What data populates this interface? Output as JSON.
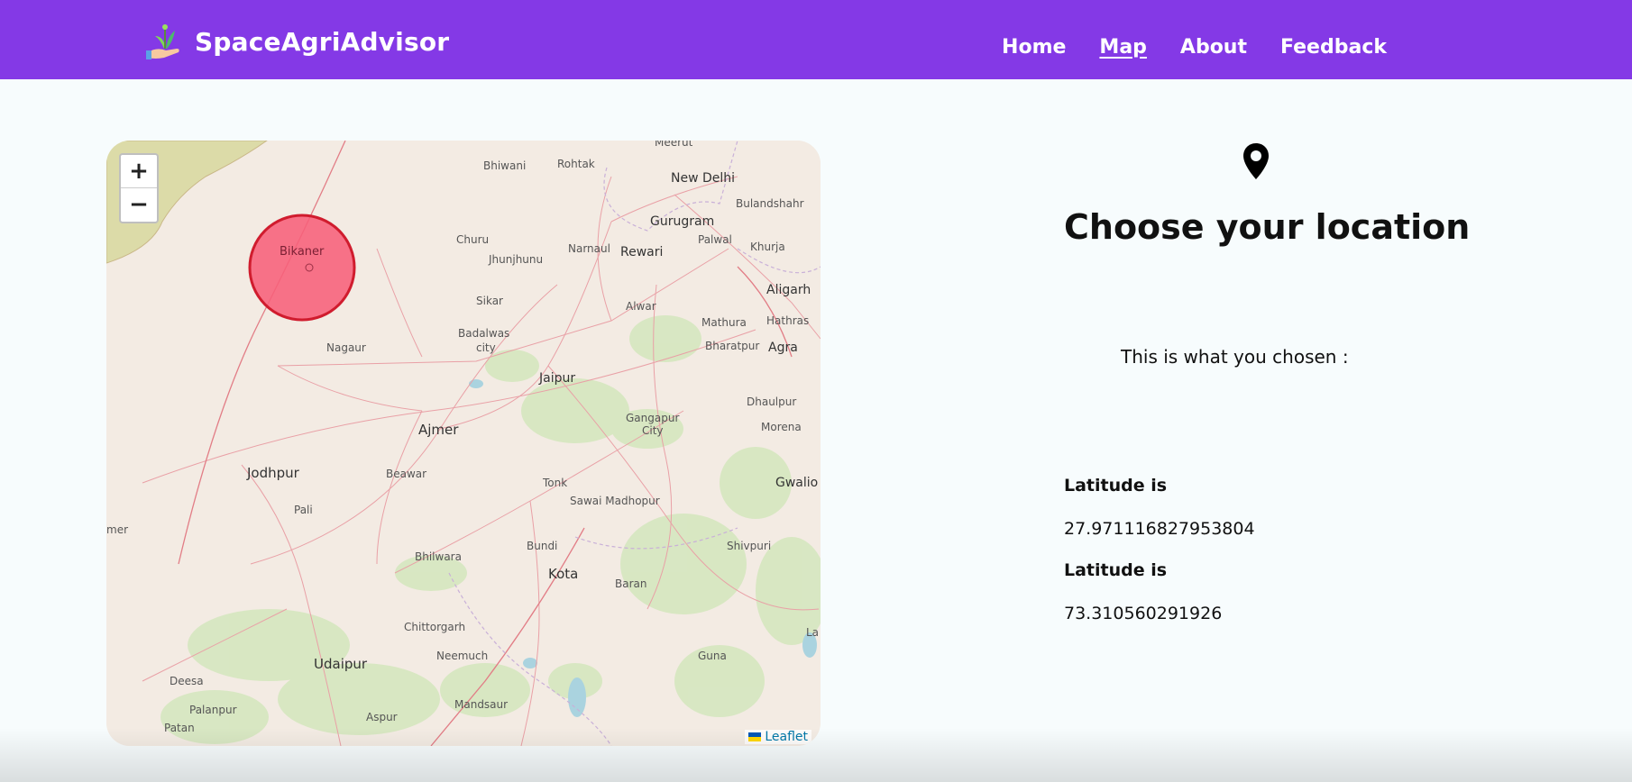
{
  "navbar": {
    "brand": "SpaceAgriAdvisor",
    "links": [
      {
        "label": "Home",
        "active": false
      },
      {
        "label": "Map",
        "active": true
      },
      {
        "label": "About",
        "active": false
      },
      {
        "label": "Feedback",
        "active": false
      }
    ]
  },
  "map": {
    "zoom_in": "+",
    "zoom_out": "−",
    "attribution": "Leaflet",
    "selected_place": "Bikaner",
    "labels": {
      "meerut": "Meerut",
      "bhiwani": "Bhiwani",
      "rohtak": "Rohtak",
      "new_delhi": "New Delhi",
      "bulandshahr": "Bulandshahr",
      "gurugram": "Gurugram",
      "churu": "Churu",
      "narnaul": "Narnaul",
      "rewari": "Rewari",
      "palwal": "Palwal",
      "khurja": "Khurja",
      "jhunjhunu": "Jhunjhunu",
      "aligarh": "Aligarh",
      "sikar": "Sikar",
      "alwar": "Alwar",
      "mathura": "Mathura",
      "hathras": "Hathras",
      "nagaur": "Nagaur",
      "badalwas": "Badalwas",
      "city1": "city",
      "bharatpur": "Bharatpur",
      "agra": "Agra",
      "jaipur": "Jaipur",
      "dhaulpur": "Dhaulpur",
      "ajmer": "Ajmer",
      "gangapur": "Gangapur",
      "city2": "City",
      "morena": "Morena",
      "jodhpur": "Jodhpur",
      "beawar": "Beawar",
      "tonk": "Tonk",
      "gwalior": "Gwalio",
      "sawai": "Sawai Madhopur",
      "pali": "Pali",
      "mer": "mer",
      "bundi": "Bundi",
      "shivpuri": "Shivpuri",
      "bhilwara": "Bhilwara",
      "kota": "Kota",
      "baran": "Baran",
      "chittorgarh": "Chittorgarh",
      "la": "La",
      "neemuch": "Neemuch",
      "guna": "Guna",
      "udaipur": "Udaipur",
      "deesa": "Deesa",
      "palanpur": "Palanpur",
      "aspur": "Aspur",
      "mandsaur": "Mandsaur",
      "patan": "Patan"
    }
  },
  "panel": {
    "title": "Choose your location",
    "chosen_text": "This is what you chosen :",
    "label1": "Latitude is",
    "value1": "27.971116827953804",
    "label2": "Latitude is",
    "value2": "73.310560291926"
  },
  "colors": {
    "navbar": "#8439e6",
    "marker_fill": "#f7607a",
    "marker_stroke": "#d01c2e",
    "background": "#f7fcfd"
  }
}
